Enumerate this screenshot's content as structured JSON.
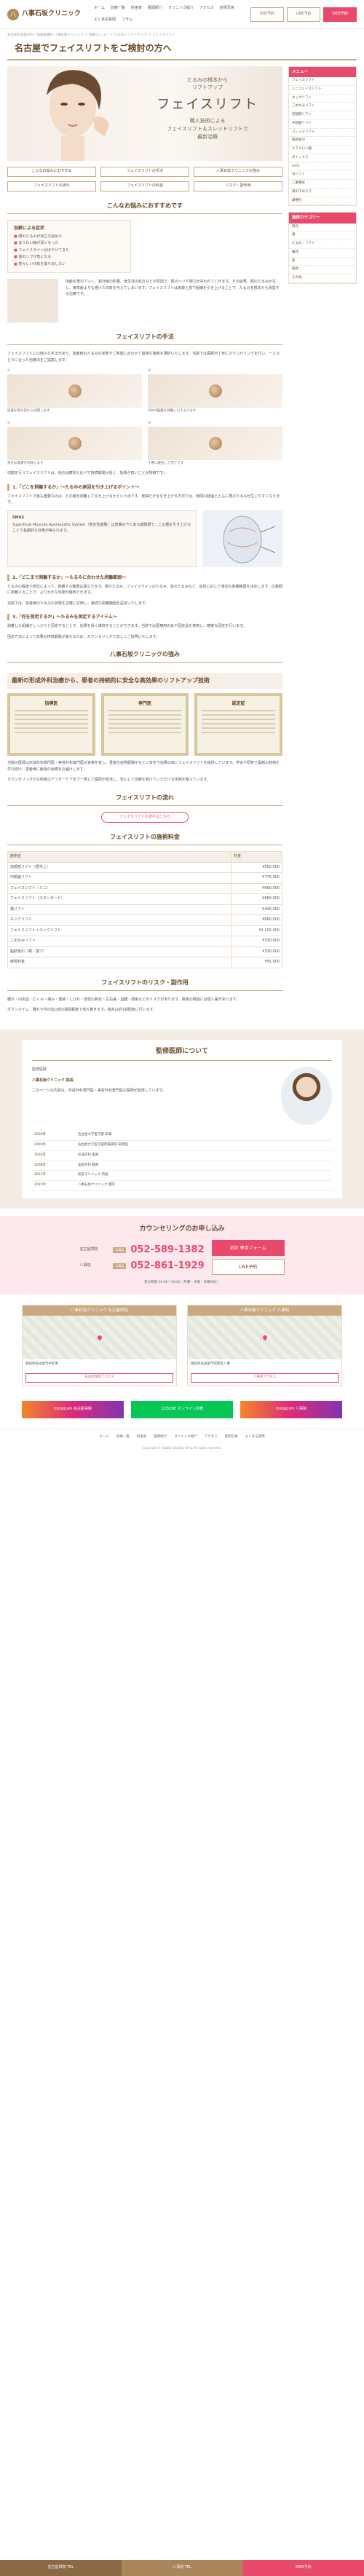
{
  "header": {
    "logo_mark": "八",
    "clinic_name": "八事石坂クリニック",
    "nav": [
      "ホーム",
      "診療一覧",
      "料金表",
      "医師紹介",
      "クリニック紹介",
      "アクセス",
      "症例写真",
      "よくある質問",
      "コラム"
    ],
    "btn_reserve": "初診予約",
    "btn_line": "LINE予約",
    "btn_web": "WEB予約"
  },
  "breadcrumb": "名古屋の美容外科・美容皮膚科 八事石坂クリニック ＞ 施術メニュー ＞ たるみ・リフトアップ ＞ フェイスリフト",
  "page_title": "名古屋でフェイスリフトをご検討の方へ",
  "hero": {
    "sub": "たるみの根本から",
    "sub2": "リフトアップ",
    "title": "フェイスリフト",
    "lead1": "職人技術による",
    "lead2": "フェイスリフト＆スレッドリフトで",
    "lead3": "最新治療"
  },
  "tabs": [
    "こんなお悩みにおすすめ",
    "フェイスリフトの手法",
    "八事石坂クリニックの強み",
    "フェイスリフトの流れ",
    "フェイスリフトの料金",
    "リスク・副作用"
  ],
  "s1": {
    "heading": "こんなお悩みにおすすめです",
    "check_title": "加齢による症状",
    "checks": [
      "顔のたるみが目立ち始めた",
      "ほうれい線が深くなった",
      "フェイスラインがぼやけてきた",
      "首のシワが気になる",
      "若々しい印象を取り戻したい"
    ],
    "text": "加齢を重ねていく、紫外線の影響、食生活の乱れなどが原因で、肌のハリや弾力が失われていきます。その結果、顔のたるみが生じ、実年齢よりも老けた印象を与えてしまいます。フェイスリフトは皮膚と皮下組織を引き上げることで、たるみを根本から改善する治療です。"
  },
  "s2": {
    "heading": "フェイスリフトの手法",
    "intro": "フェイスリフトには様々な手法があり、患者様のたるみの状態やご希望に合わせて最適な施術を選択いたします。当院では医師が丁寧にカウンセリングを行い、一人ひとりに合った治療法をご提案します。",
    "photos": [
      {
        "label": "①",
        "cap": "皮膚を耳の前から切開します"
      },
      {
        "label": "②",
        "cap": "SMAS筋膜を剥離し引き上げます"
      },
      {
        "label": "③",
        "cap": "余分な皮膚を切除します"
      },
      {
        "label": "④",
        "cap": "丁寧に縫合して完了です"
      }
    ],
    "body": "切開を行うフェイスリフトは、他の治療法と比べて持続期間が長く、効果が高いことが特徴です。"
  },
  "method1": {
    "heading": "1.「どこを剥離するか」〜たるみの原因を引き上げるポイント〜",
    "text": "フェイスリフトで最も重要なのは、どの層を剥離して引き上げるかという点です。皮膚だけを引き上げる方法では、時間の経過とともに再びたるみが生じやすくなります。",
    "diagram_title": "SMAS",
    "diagram_text": "Superficial Musculo Aponeurotic System（表在性筋膜）は皮膚の下にある筋膜層で、この層を引き上げることで長期的な効果が得られます。"
  },
  "method2": {
    "heading": "2.「どこまで剥離するか」〜たるみに合わせた剥離範囲〜",
    "text": "たるみの程度や部位によって、剥離する範囲は異なります。頬のたるみ、フェイスラインのたるみ、首のたるみなど、症状に応じて適切な剥離範囲を決定します。広範囲に剥離することで、より大きな効果が期待できます。",
    "text2": "当院では、患者様のたるみの状態を正確に診断し、最適な剥離範囲を設定いたします。"
  },
  "method3": {
    "heading": "3.「何を使用するか」〜たるみを固定するアイテム〜",
    "text": "剥離した組織をしっかりと固定することで、効果を長く維持することができます。当院では医療用の糸や固定具を使用し、確実な固定を行います。",
    "text2": "固定方法によって効果の持続期間が異なるため、カウンセリングで詳しくご説明いたします。"
  },
  "strength": {
    "heading": "八事石坂クリニックの強み",
    "sub": "最新の形成外科治療から、患者の持続的に安全な高効果のリフトアップ技術",
    "certs": [
      "指導医",
      "専門医",
      "認定証"
    ],
    "text": "当院の医師は形成外科専門医・美容外科専門医の資格を有し、豊富な症例経験をもとに安全で効果の高いフェイスリフトを提供しています。学会や研修で最新の技術を学び続け、患者様に最良の治療をお届けします。",
    "text2": "カウンセリングから術後のアフターケアまで一貫して医師が担当し、安心して治療を受けていただける体制を整えています。"
  },
  "flow": {
    "heading": "フェイスリフトの流れ",
    "link": "フェイスリフトの流れはこちら"
  },
  "price": {
    "heading": "フェイスリフトの施術料金",
    "col_menu": "施術名",
    "col_price": "料金",
    "rows": [
      {
        "name": "前額部リフト（眉毛上）",
        "price": "¥550,000"
      },
      {
        "name": "中顔面リフト",
        "price": "¥770,000"
      },
      {
        "name": "フェイスリフト（ミニ）",
        "price": "¥660,000"
      },
      {
        "name": "フェイスリフト（スタンダード）",
        "price": "¥880,000"
      },
      {
        "name": "頬リフト",
        "price": "¥440,000"
      },
      {
        "name": "ネックリフト",
        "price": "¥660,000"
      },
      {
        "name": "フェイスリフト＋ネックリフト",
        "price": "¥1,100,000"
      },
      {
        "name": "こめかみリフト",
        "price": "¥330,000"
      },
      {
        "name": "脂肪吸引（頬・顎下）",
        "price": "¥330,000"
      },
      {
        "name": "麻酔料金",
        "price": "¥55,000"
      }
    ]
  },
  "risk": {
    "heading": "フェイスリフトのリスク・副作用",
    "text": "腫れ・内出血・むくみ・痛み・傷跡・しびれ・感覚の鈍化・左右差・血腫・感染などのリスクがあります。術後の経過には個人差があります。",
    "text2": "ダウンタイム：腫れや内出血は約2週間程度で落ち着きます。抜糸は約1週間後に行います。"
  },
  "doctor": {
    "heading": "監修医師について",
    "role": "監修医師",
    "name": "八事石坂クリニック 院長",
    "desc": "このページの内容は、形成外科専門医・美容外科専門医の医師が監修しています。",
    "history": [
      {
        "year": "2000年",
        "text": "名古屋大学医学部 卒業"
      },
      {
        "year": "2000年",
        "text": "名古屋大学医学部附属病院 研修医"
      },
      {
        "year": "2002年",
        "text": "形成外科 医員"
      },
      {
        "year": "2008年",
        "text": "美容外科 勤務"
      },
      {
        "year": "2012年",
        "text": "美容クリニック 院長"
      },
      {
        "year": "2015年",
        "text": "八事石坂クリニック 開院"
      }
    ]
  },
  "counsel": {
    "heading": "カウンセリングのお申し込み",
    "tel1_label": "名古屋栄院",
    "tel1_badge": "お電話",
    "tel1": "052-589-1382",
    "tel2_label": "八事院",
    "tel2_badge": "お電話",
    "tel2": "052-861-1929",
    "btn_form": "初診 専用フォーム",
    "btn_line": "LINE予約",
    "hours": "受付時間 10:00〜19:00（月曜・水曜・日曜休診）"
  },
  "access": [
    {
      "title": "八事石坂クリニック 名古屋栄院",
      "addr": "愛知県名古屋市中区栄",
      "btn": "名古屋栄院アクセス"
    },
    {
      "title": "八事石坂クリニック 八事院",
      "addr": "愛知県名古屋市昭和区八事",
      "btn": "八事院アクセス"
    }
  ],
  "banners": [
    {
      "label": "Instagram 名古屋栄院"
    },
    {
      "label": "公式LINE オンライン診療"
    },
    {
      "label": "Instagram 八事院"
    }
  ],
  "footer_nav": [
    "ホーム",
    "診療一覧",
    "料金表",
    "医師紹介",
    "クリニック紹介",
    "アクセス",
    "症例写真",
    "よくある質問"
  ],
  "copyright": "Copyright © Yagoto Ishizaka Clinic All rights reserved.",
  "fixbar": [
    "名古屋栄院 TEL",
    "八事院 TEL",
    "WEB予約"
  ],
  "sidebar": {
    "menu_heading": "メニュー",
    "menu": [
      "フェイスリフト",
      "ミニフェイスリフト",
      "ネックリフト",
      "こめかみリフト",
      "前額部リフト",
      "中顔面リフト",
      "スレッドリフト",
      "脂肪吸引",
      "ヒアルロン酸",
      "ボトックス",
      "HIFU",
      "糸リフト",
      "二重整形",
      "目の下のクマ",
      "鼻整形"
    ],
    "case_heading": "施術カテゴリー",
    "cases": [
      "目元",
      "鼻",
      "たるみ・リフト",
      "輪郭",
      "肌",
      "脂肪",
      "その他"
    ]
  }
}
